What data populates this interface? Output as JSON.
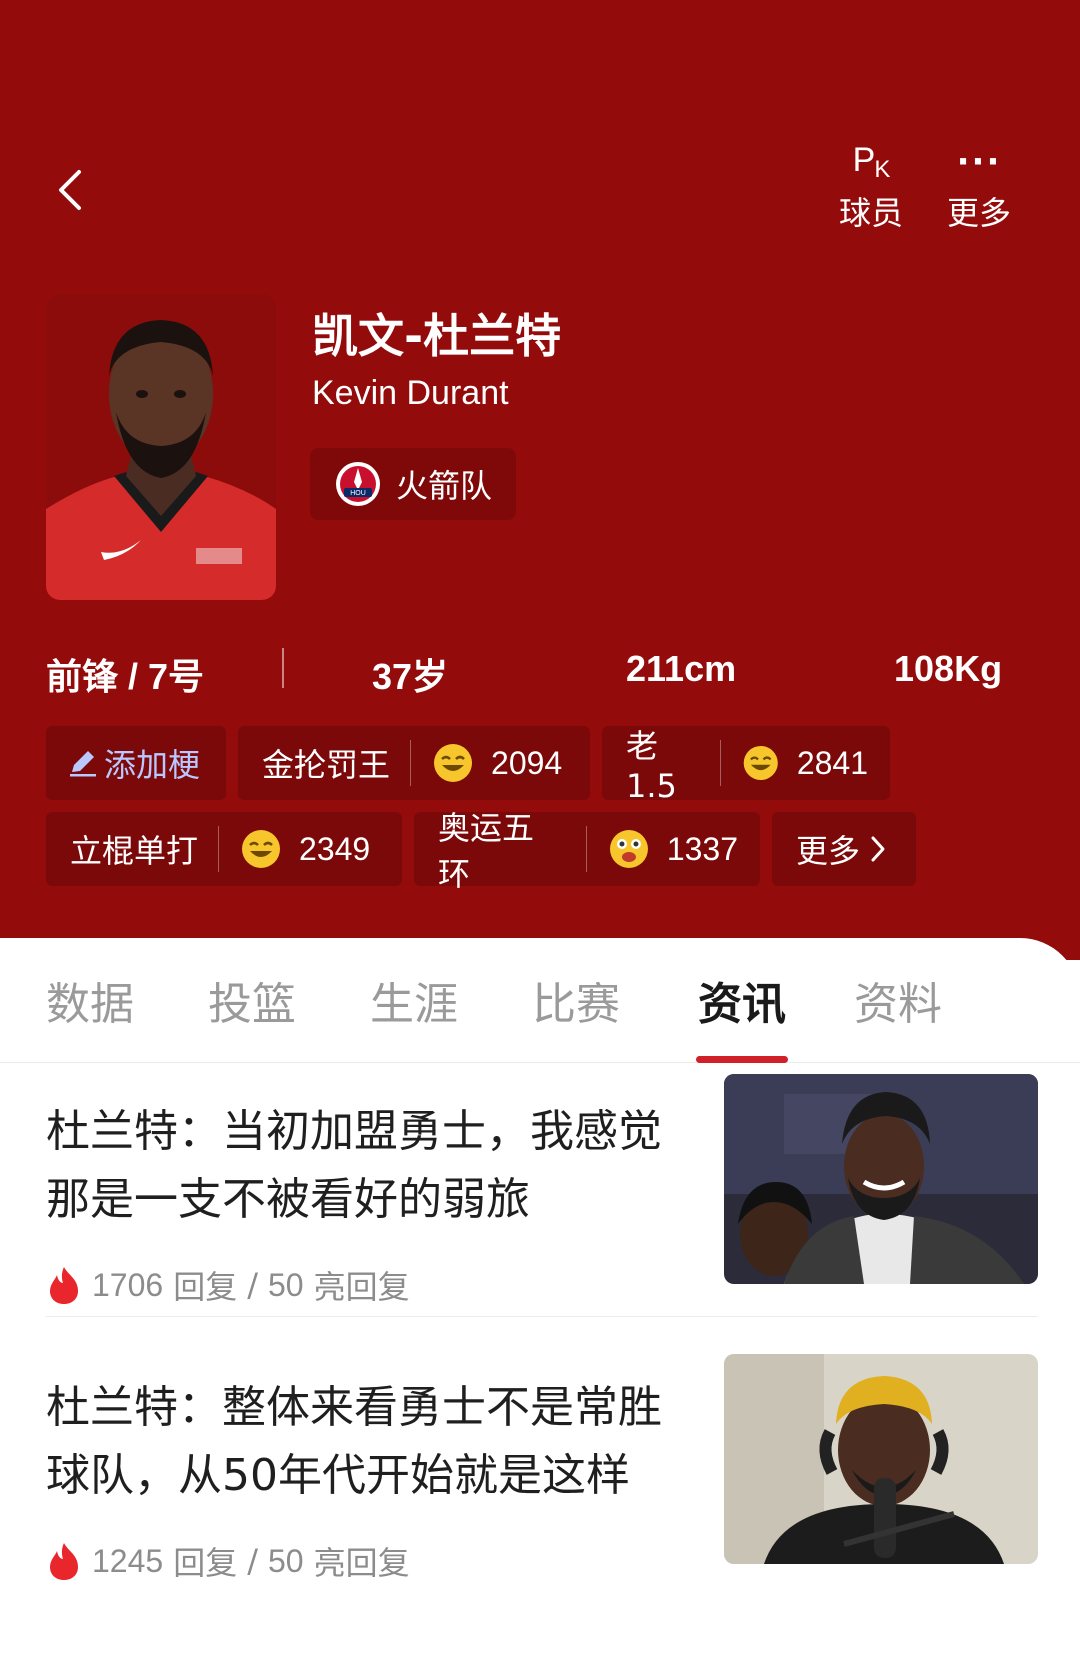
{
  "nav": {
    "pk_main": "P",
    "pk_sub": "K",
    "pk_label": "球员",
    "more_label": "更多"
  },
  "player": {
    "name_cn": "凯文-杜兰特",
    "name_en": "Kevin Durant",
    "team": "火箭队",
    "position": "前锋 / 7号",
    "age": "37岁",
    "height": "211cm",
    "weight": "108Kg"
  },
  "tags": {
    "add_label": "添加梗",
    "items": [
      {
        "text": "金抡罚王",
        "count": "2094",
        "icon": "laugh-emoji-icon"
      },
      {
        "text": "老1.5",
        "count": "2841",
        "icon": "laugh-emoji-icon"
      },
      {
        "text": "立棍单打",
        "count": "2349",
        "icon": "laugh-emoji-icon"
      },
      {
        "text": "奥运五环",
        "count": "1337",
        "icon": "surprised-emoji-icon"
      }
    ],
    "more_label": "更多"
  },
  "tabs": [
    "数据",
    "投篮",
    "生涯",
    "比赛",
    "资讯",
    "资料"
  ],
  "active_tab": "资讯",
  "news": [
    {
      "title": "杜兰特：当初加盟勇士，我感觉那是一支不被看好的弱旅",
      "replies": "1706",
      "reply_label": "回复",
      "sep": "/",
      "lights": "50",
      "light_label": "亮回复"
    },
    {
      "title": "杜兰特：整体来看勇士不是常胜球队，从50年代开始就是这样",
      "replies": "1245",
      "reply_label": "回复",
      "sep": "/",
      "lights": "50",
      "light_label": "亮回复"
    }
  ],
  "colors": {
    "header_bg": "#940b0b",
    "accent": "#d0202a",
    "fire": "#e8262c"
  }
}
